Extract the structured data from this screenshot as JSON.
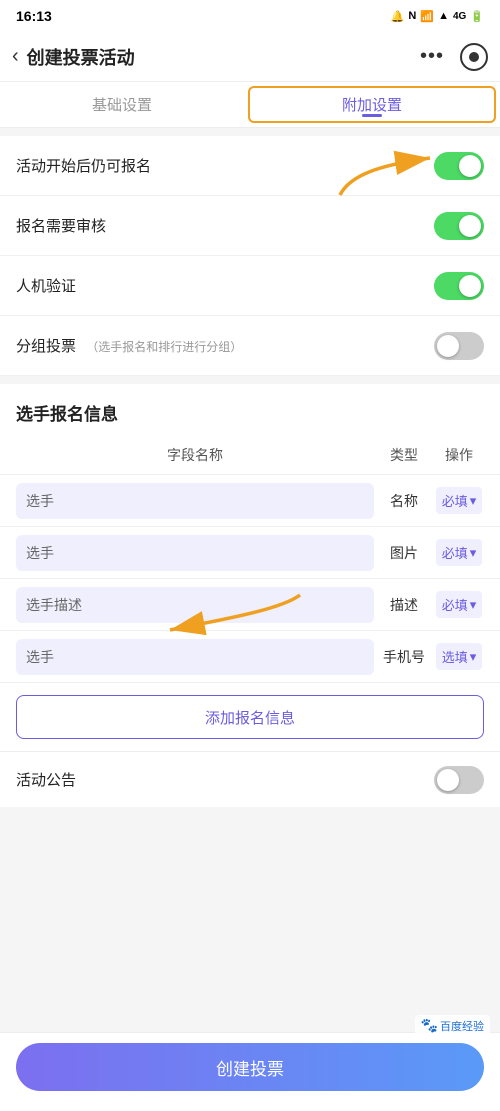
{
  "statusBar": {
    "time": "16:13",
    "icons": "🔔 N 📶 🔋"
  },
  "nav": {
    "back": "‹",
    "title": "创建投票活动",
    "more": "•••"
  },
  "tabs": [
    {
      "id": "basic",
      "label": "基础设置",
      "active": false
    },
    {
      "id": "extra",
      "label": "附加设置",
      "active": true
    }
  ],
  "settings": [
    {
      "id": "allow-signup-after-start",
      "label": "活动开始后仍可报名",
      "sub": "",
      "enabled": true
    },
    {
      "id": "signup-review",
      "label": "报名需要审核",
      "sub": "",
      "enabled": true
    },
    {
      "id": "captcha",
      "label": "人机验证",
      "sub": "",
      "enabled": true
    },
    {
      "id": "group-vote",
      "label": "分组投票",
      "sub": "（选手报名和排行进行分组）",
      "enabled": false
    }
  ],
  "registrationSection": {
    "title": "选手报名信息",
    "tableHeaders": {
      "name": "字段名称",
      "type": "类型",
      "action": "操作"
    },
    "rows": [
      {
        "id": "row1",
        "name": "选手",
        "type": "名称",
        "required": true,
        "requiredLabel": "必填",
        "hasDropdown": true
      },
      {
        "id": "row2",
        "name": "选手",
        "type": "图片",
        "required": true,
        "requiredLabel": "必填",
        "hasDropdown": true
      },
      {
        "id": "row3",
        "name": "选手描述",
        "type": "描述",
        "required": true,
        "requiredLabel": "必填",
        "hasDropdown": true
      },
      {
        "id": "row4",
        "name": "选手",
        "type": "手机号",
        "required": false,
        "requiredLabel": "选填",
        "hasDropdown": true
      }
    ],
    "addButton": "添加报名信息"
  },
  "noticeRow": {
    "label": "活动公告",
    "enabled": false
  },
  "bottomButton": {
    "label": "创建投票"
  },
  "watermark": {
    "icon": "🐾",
    "text": "百度经验"
  }
}
